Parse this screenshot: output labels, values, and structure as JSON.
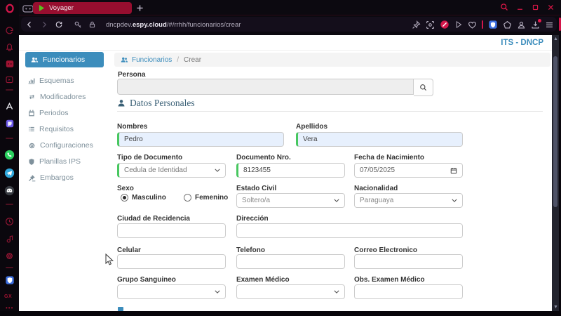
{
  "browser": {
    "tab": {
      "title": "Voyager"
    },
    "address": {
      "url_pre": "dncpdev.",
      "url_host": "espy.cloud",
      "url_path": "/#/rrhh/funcionarios/crear"
    },
    "rail": {
      "gx_label": "GX"
    }
  },
  "app": {
    "brand": "ITS - DNCP",
    "sidebar": {
      "items": [
        {
          "label": "Funcionarios",
          "active": true
        },
        {
          "label": "Esquemas",
          "active": false
        },
        {
          "label": "Modificadores",
          "active": false
        },
        {
          "label": "Periodos",
          "active": false
        },
        {
          "label": "Requisitos",
          "active": false
        },
        {
          "label": "Configuraciones",
          "active": false
        },
        {
          "label": "Planillas IPS",
          "active": false
        },
        {
          "label": "Embargos",
          "active": false
        }
      ]
    },
    "breadcrumb": {
      "root": "Funcionarios",
      "separator": "/",
      "current": "Crear"
    },
    "form": {
      "persona": {
        "label": "Persona",
        "value": ""
      },
      "section_title": "Datos Personales",
      "nombres": {
        "label": "Nombres",
        "value": "Pedro"
      },
      "apellidos": {
        "label": "Apellidos",
        "value": "Vera"
      },
      "tipo_documento": {
        "label": "Tipo de Documento",
        "value": "Cedula de Identidad"
      },
      "documento_nro": {
        "label": "Documento Nro.",
        "value": "8123455"
      },
      "fecha_nacimiento": {
        "label": "Fecha de Nacimiento",
        "value": "07/05/2025"
      },
      "sexo": {
        "label": "Sexo",
        "options": [
          {
            "label": "Masculino",
            "checked": true
          },
          {
            "label": "Femenino",
            "checked": false
          }
        ]
      },
      "estado_civil": {
        "label": "Estado Civil",
        "value": "Soltero/a"
      },
      "nacionalidad": {
        "label": "Nacionalidad",
        "value": "Paraguaya"
      },
      "ciudad_residencia": {
        "label": "Ciudad de Recidencia",
        "value": ""
      },
      "direccion": {
        "label": "Dirección",
        "value": ""
      },
      "celular": {
        "label": "Celular",
        "value": ""
      },
      "telefono": {
        "label": "Telefono",
        "value": ""
      },
      "correo": {
        "label": "Correo Electronico",
        "value": ""
      },
      "grupo_sanguineo": {
        "label": "Grupo Sanguineo",
        "value": ""
      },
      "examen_medico": {
        "label": "Examen Médico",
        "value": ""
      },
      "obs_examen_medico": {
        "label": "Obs. Examen Médico",
        "value": ""
      }
    },
    "colors": {
      "accent_blue": "#3c8dbc",
      "valid_green": "#48c760",
      "autofill_blue": "#e7f0fd",
      "crimson": "#d3164a",
      "section_heading": "#3a6076"
    }
  }
}
